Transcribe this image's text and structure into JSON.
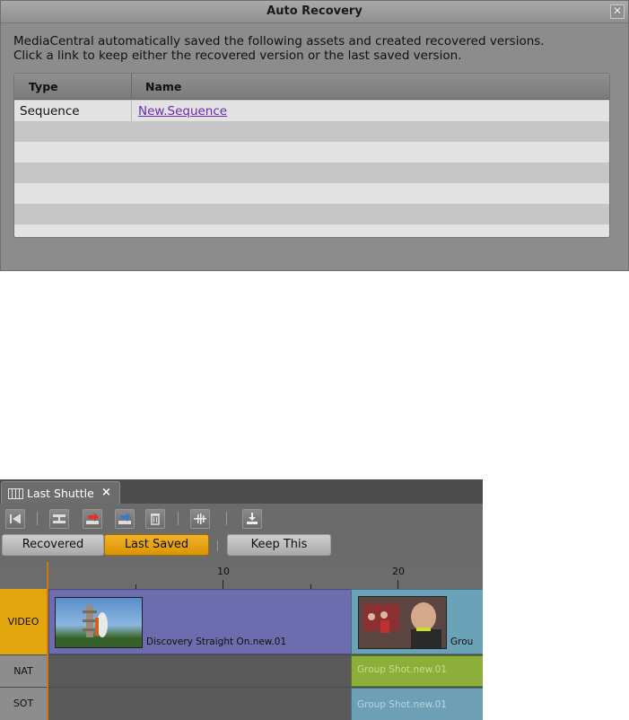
{
  "dialog": {
    "title": "Auto Recovery",
    "close_glyph": "✕",
    "message_line1": "MediaCentral automatically saved the following assets and created recovered versions.",
    "message_line2": "Click a link to keep either the recovered version or the last saved version.",
    "table": {
      "columns": [
        "Type",
        "Name"
      ],
      "rows": [
        {
          "type": "Sequence",
          "name": "New.Sequence"
        }
      ]
    }
  },
  "timeline": {
    "tab": {
      "label": "Last Shuttle",
      "close_glyph": "×"
    },
    "toolbar_icons": [
      "go-to-start-icon",
      "splice-icon",
      "overwrite-right-icon",
      "overwrite-blue-icon",
      "delete-icon",
      "audio-waveform-icon",
      "download-icon"
    ],
    "buttons": {
      "recovered": "Recovered",
      "last_saved": "Last Saved",
      "keep_this": "Keep This"
    },
    "ruler_ticks": [
      "10",
      "20"
    ],
    "tracks": {
      "video": "VIDEO",
      "nat": "NAT",
      "sot": "SOT"
    },
    "clips": {
      "video1": "Discovery Straight On.new.01",
      "video2": "Grou",
      "nat2": "Group Shot.new.01",
      "sot2": "Group Shot.new.01"
    },
    "colors": {
      "active_button": "#e3a60e",
      "video_track": "#e3a60e",
      "video_clip_1": "#6d6cae",
      "video_clip_2": "#6aa2b8",
      "nat_clip": "#8caf3a",
      "sot_clip": "#6ea0b5"
    }
  }
}
